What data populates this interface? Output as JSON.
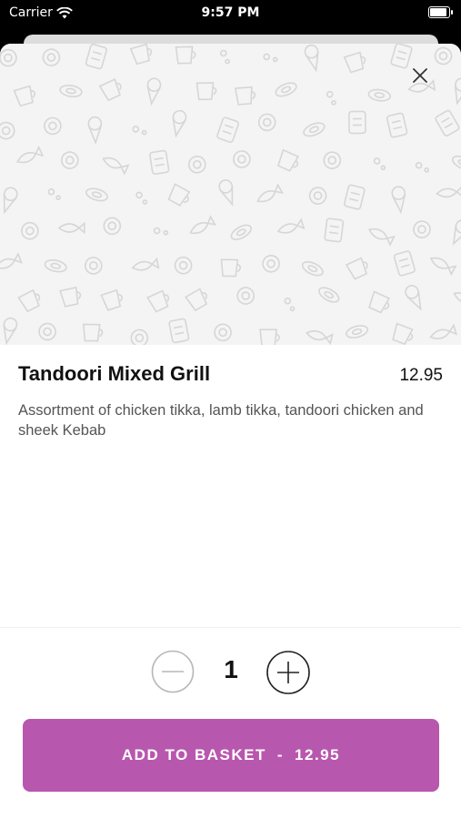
{
  "status_bar": {
    "carrier": "Carrier",
    "time": "9:57 PM",
    "battery_level": 0.95
  },
  "item": {
    "title": "Tandoori Mixed Grill",
    "price": "12.95",
    "description": "Assortment of chicken tikka, lamb tikka, tandoori chicken and sheek Kebab"
  },
  "quantity": {
    "value": "1"
  },
  "add_button": {
    "label": "ADD TO BASKET",
    "separator": "-",
    "price": "12.95"
  },
  "colors": {
    "accent": "#b857ae",
    "hero_background": "#f4f4f4",
    "doodle_stroke": "#d6d6d6"
  },
  "icons": {
    "close": "close-icon",
    "minus": "minus-circle-icon",
    "plus": "plus-circle-icon",
    "wifi": "wifi-icon",
    "battery": "battery-icon"
  }
}
